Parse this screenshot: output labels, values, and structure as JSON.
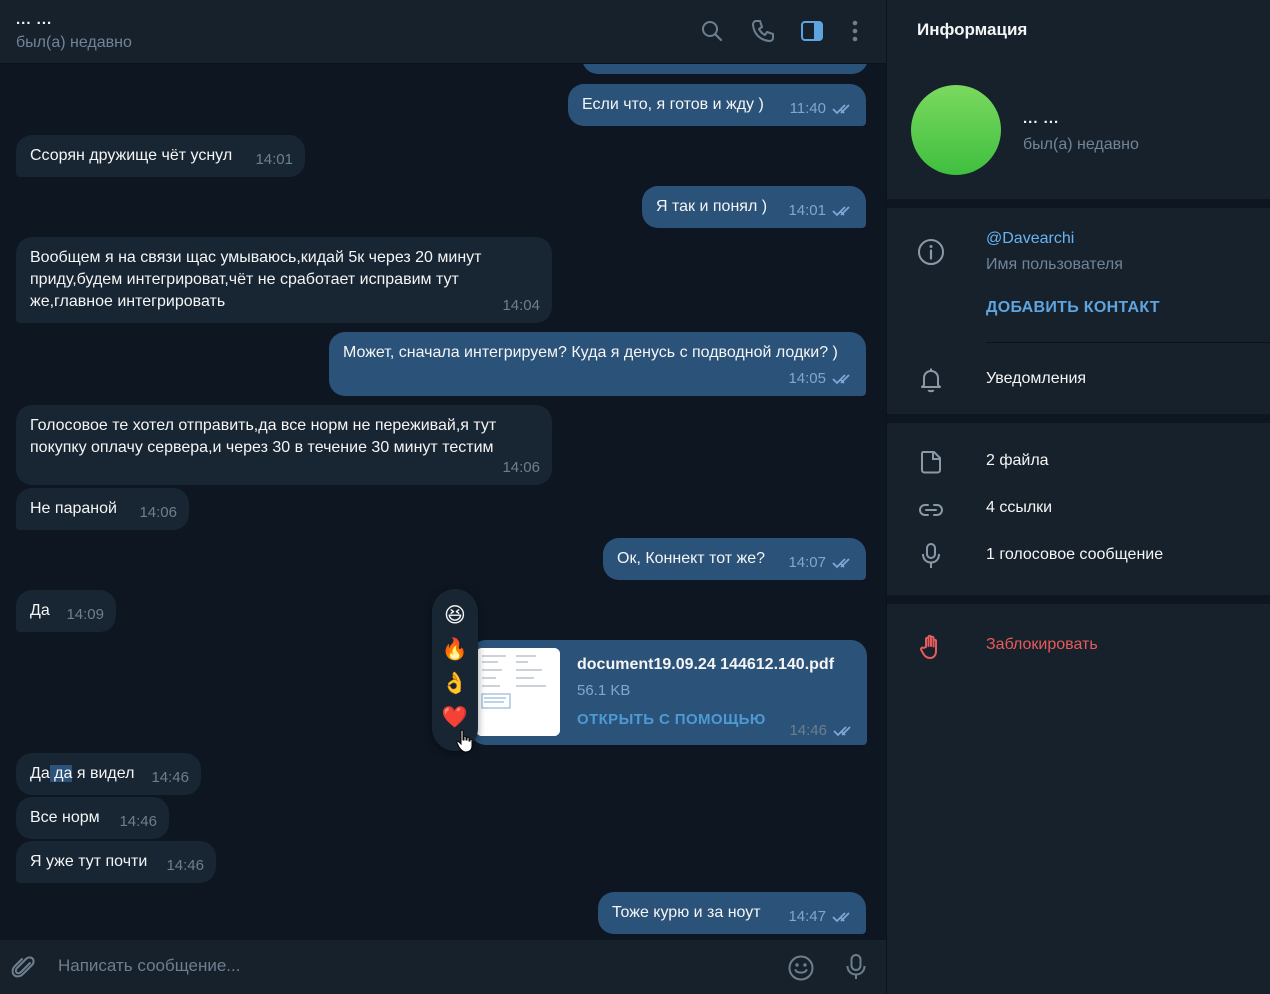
{
  "chat_header": {
    "title": "... ...",
    "status": "был(а) недавно",
    "icons": [
      "search-icon",
      "phone-icon",
      "sidebar-toggle-icon",
      "more-vertical-icon"
    ]
  },
  "messages": [
    {
      "direction": "out",
      "text": "Если что, я готов и жду )",
      "time": "11:40",
      "read": true
    },
    {
      "direction": "in",
      "text": "Ссорян дружище чёт уснул",
      "time": "14:01"
    },
    {
      "direction": "out",
      "text": "Я так и понял )",
      "time": "14:01",
      "read": true
    },
    {
      "direction": "in",
      "text": "Вообщем я на связи щас умываюсь,кидай 5к через 20 минут приду,будем интегрироват,чёт не сработает исправим тут же,главное интегрировать",
      "time": "14:04"
    },
    {
      "direction": "out",
      "text": "Может, сначала интегрируем? Куда я денусь с подводной лодки? )",
      "time": "14:05",
      "read": true
    },
    {
      "direction": "in",
      "text": "Голосовое те хотел отправить,да все норм не переживай,я тут покупку оплачу сервера,и через 30 в течение 30 минут тестим",
      "time": "14:06"
    },
    {
      "direction": "in",
      "text": "Не параной",
      "time": "14:06"
    },
    {
      "direction": "out",
      "text": "Ок, Коннект тот же?",
      "time": "14:07",
      "read": true
    },
    {
      "direction": "in",
      "text": "Да",
      "time": "14:09"
    },
    {
      "direction": "in",
      "text_parts": [
        "Да",
        " да",
        " я видел"
      ],
      "time": "14:46"
    },
    {
      "direction": "in",
      "text": "Все норм",
      "time": "14:46"
    },
    {
      "direction": "in",
      "text": "Я уже тут почти",
      "time": "14:46"
    },
    {
      "direction": "out",
      "text": "Тоже курю и за ноут",
      "time": "14:47",
      "read": true
    }
  ],
  "file_message": {
    "name": "document19.09.24 144612.140.pdf",
    "size": "56.1 KB",
    "action": "ОТКРЫТЬ С ПОМОЩЬЮ",
    "time": "14:46",
    "read": true
  },
  "reactions": [
    "😆",
    "🔥",
    "👌",
    "❤️"
  ],
  "input": {
    "placeholder": "Написать сообщение...",
    "icons": [
      "attach-icon",
      "emoji-icon",
      "microphone-icon"
    ]
  },
  "info_panel": {
    "title": "Информация",
    "name": "... ...",
    "status": "был(а) недавно",
    "username": "@Davearchi",
    "username_label": "Имя пользователя",
    "add_contact": "ДОБАВИТЬ КОНТАКТ",
    "notifications": "Уведомления",
    "files": "2 файла",
    "links": "4 ссылки",
    "voice": "1 голосовое сообщение",
    "block": "Заблокировать"
  },
  "colors": {
    "background": "#0e1621",
    "panel": "#17212b",
    "incoming_bubble": "#182533",
    "outgoing_bubble": "#2b5278",
    "accent": "#6ab3f3",
    "danger": "#e65b5b",
    "avatar": "#5cc94b"
  }
}
